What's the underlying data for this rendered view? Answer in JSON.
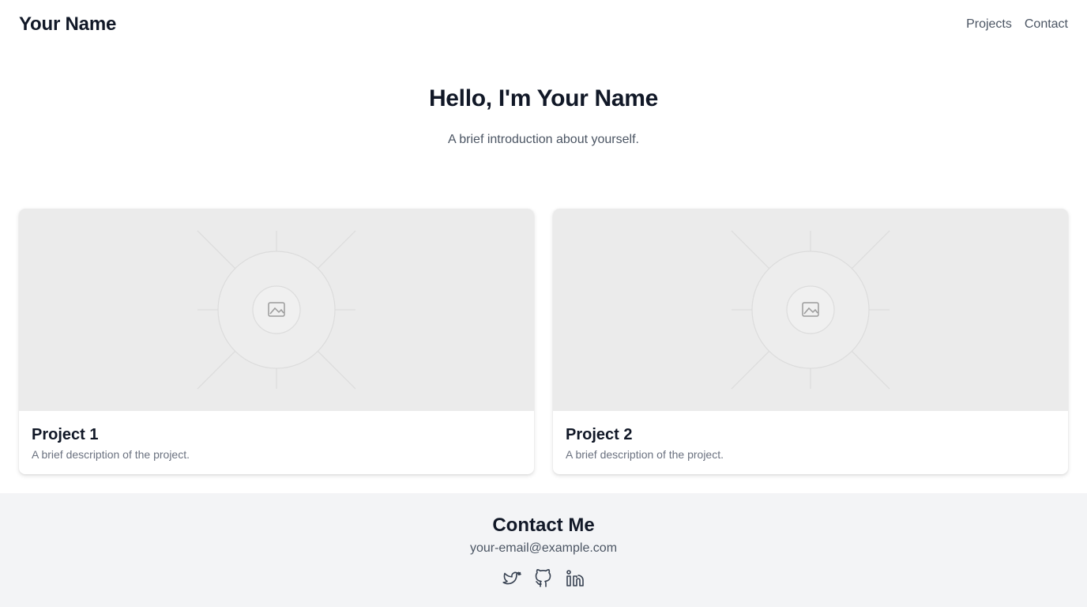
{
  "header": {
    "brand": "Your Name",
    "nav": [
      "Projects",
      "Contact"
    ]
  },
  "hero": {
    "title": "Hello, I'm Your Name",
    "subtitle": "A brief introduction about yourself."
  },
  "projects": [
    {
      "title": "Project 1",
      "description": "A brief description of the project.",
      "image_icon": "image-placeholder-icon"
    },
    {
      "title": "Project 2",
      "description": "A brief description of the project.",
      "image_icon": "image-placeholder-icon"
    }
  ],
  "contact": {
    "title": "Contact Me",
    "email": "your-email@example.com",
    "socials": [
      "twitter-icon",
      "github-icon",
      "linkedin-icon"
    ]
  },
  "colors": {
    "text_primary": "#111827",
    "text_secondary": "#4b5563",
    "text_muted": "#6b7280",
    "footer_bg": "#f3f4f6",
    "placeholder_bg": "#ebebeb"
  }
}
